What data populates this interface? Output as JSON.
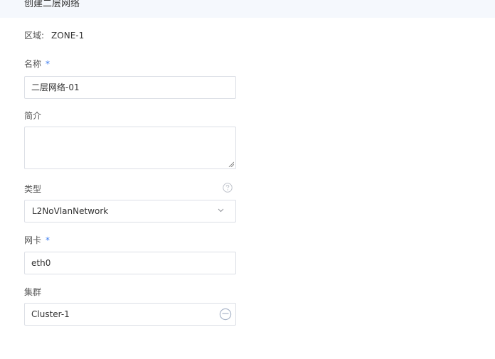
{
  "header": {
    "title": "创建二层网络"
  },
  "zone": {
    "label": "区域:",
    "value": "ZONE-1"
  },
  "name": {
    "label": "名称",
    "required_mark": "*",
    "value": "二层网络-01"
  },
  "description": {
    "label": "简介",
    "value": ""
  },
  "type": {
    "label": "类型",
    "selected": "L2NoVlanNetwork"
  },
  "nic": {
    "label": "网卡",
    "required_mark": "*",
    "value": "eth0"
  },
  "cluster": {
    "label": "集群",
    "value": "Cluster-1"
  },
  "icons": {
    "help": "question-circle-icon",
    "select": "chevron-down-icon",
    "cluster_picker": "minus-circle-icon"
  },
  "colors": {
    "accent": "#3c7cf0",
    "header_bg": "#f5f8fd",
    "border": "#dcdfe6",
    "icon_gray": "#c0c4cc"
  }
}
